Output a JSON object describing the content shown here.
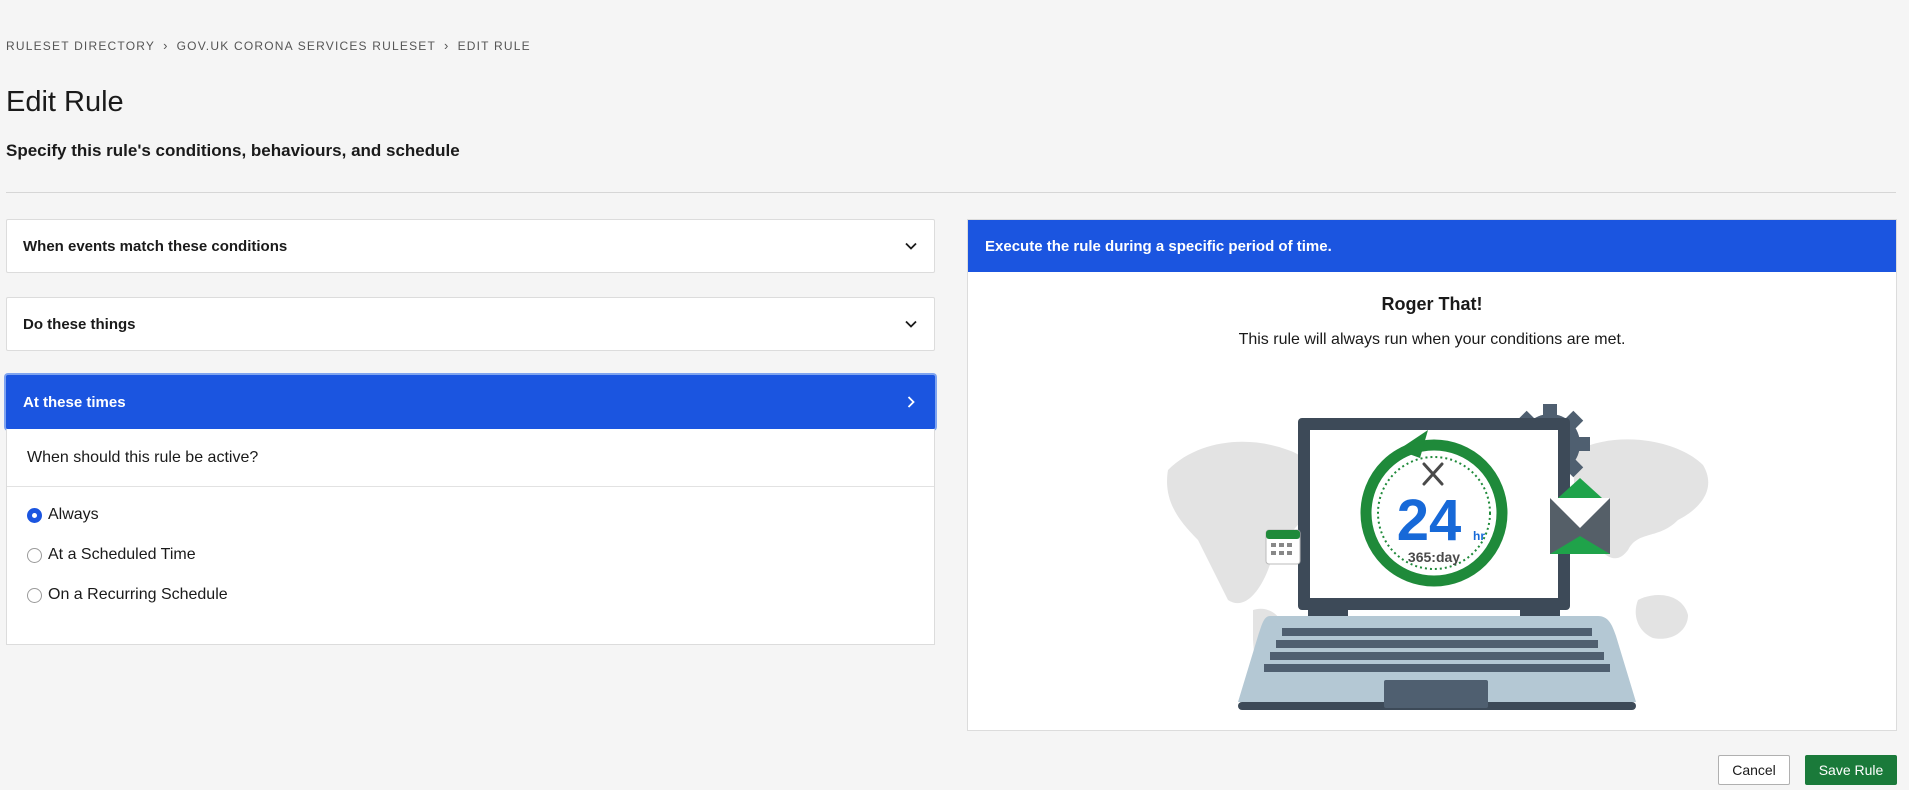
{
  "breadcrumb": [
    {
      "label": "RULESET DIRECTORY"
    },
    {
      "label": "GOV.UK CORONA SERVICES RULESET"
    },
    {
      "label": "EDIT RULE"
    }
  ],
  "breadcrumb_separator": "›",
  "page": {
    "title": "Edit Rule",
    "subtitle": "Specify this rule's conditions, behaviours, and schedule"
  },
  "sections": [
    {
      "label": "When events match these conditions",
      "icon": "chevron-down-icon",
      "active": false
    },
    {
      "label": "Do these things",
      "icon": "chevron-down-icon",
      "active": false
    },
    {
      "label": "At these times",
      "icon": "chevron-right-icon",
      "active": true
    }
  ],
  "schedule": {
    "question": "When should this rule be active?",
    "options": [
      {
        "label": "Always",
        "selected": true
      },
      {
        "label": "At a Scheduled Time",
        "selected": false
      },
      {
        "label": "On a Recurring Schedule",
        "selected": false
      }
    ]
  },
  "info": {
    "header": "Execute the rule during a specific period of time.",
    "title": "Roger That!",
    "text": "This rule will always run when your conditions are met.",
    "illustration": {
      "clock_number": "24",
      "clock_unit": "hr",
      "clock_caption": "365:day"
    }
  },
  "actions": {
    "cancel_label": "Cancel",
    "save_label": "Save Rule"
  },
  "colors": {
    "accent": "#1b55e0",
    "save_green": "#1a7a3a",
    "illus_green": "#1f8a3a"
  }
}
